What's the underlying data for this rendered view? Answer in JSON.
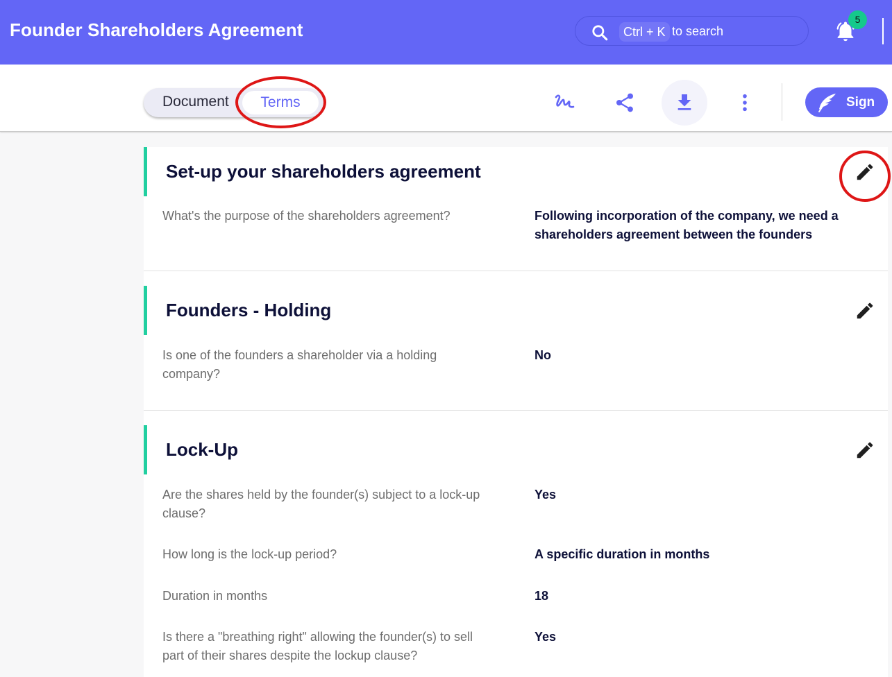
{
  "header": {
    "title": "Founder Shareholders Agreement",
    "search_shortcut": "Ctrl + K",
    "search_text": "to search",
    "notification_count": "5"
  },
  "toolbar": {
    "tabs": [
      {
        "label": "Document",
        "active": false
      },
      {
        "label": "Terms",
        "active": true
      }
    ],
    "sign_label": "Sign",
    "icons": [
      "signature-icon",
      "share-icon",
      "download-icon",
      "more-vertical-icon",
      "quill-icon"
    ]
  },
  "sections": [
    {
      "title": "Set-up your shareholders agreement",
      "rows": [
        {
          "question": "What's the purpose of the shareholders agreement?",
          "answer": "Following incorporation of the company, we need a shareholders agreement between the founders"
        }
      ]
    },
    {
      "title": "Founders - Holding",
      "rows": [
        {
          "question": "Is one of the founders a shareholder via a holding company?",
          "answer": "No"
        }
      ]
    },
    {
      "title": "Lock-Up",
      "rows": [
        {
          "question": "Are the shares held by the founder(s) subject to a lock-up clause?",
          "answer": "Yes"
        },
        {
          "question": "How long is the lock-up period?",
          "answer": "A specific duration in months"
        },
        {
          "question": "Duration in months",
          "answer": "18"
        },
        {
          "question": "Is there a \"breathing right\" allowing the founder(s) to sell part of their shares despite the lockup clause?",
          "answer": "Yes"
        }
      ]
    }
  ],
  "colors": {
    "accent": "#6366f6",
    "section_bar": "#21cfa0",
    "badge": "#15c98c",
    "annotation": "#de1616"
  }
}
